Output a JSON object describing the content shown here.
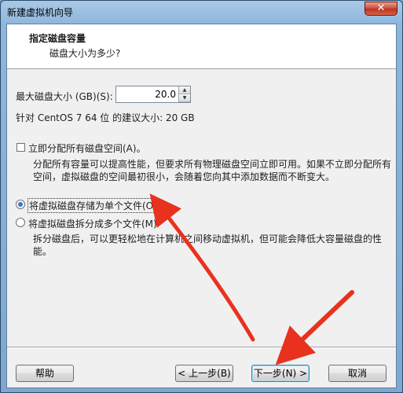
{
  "window": {
    "title": "新建虚拟机向导",
    "close_label": "✕"
  },
  "header": {
    "title": "指定磁盘容量",
    "subtitle": "磁盘大小为多少?"
  },
  "disk": {
    "size_label": "最大磁盘大小 (GB)(S):",
    "size_value": "20.0",
    "recommend_text": "针对 CentOS 7 64 位 的建议大小: 20 GB"
  },
  "options": {
    "allocate_label": "立即分配所有磁盘空间(A)。",
    "allocate_desc_line1": "分配所有容量可以提高性能，但要求所有物理磁盘空间立即可用。如果不立即分配所有",
    "allocate_desc_line2": "空间，虚拟磁盘的空间最初很小，会随着您向其中添加数据而不断变大。",
    "single_file_label": "将虚拟磁盘存储为单个文件(O)",
    "multi_file_label": "将虚拟磁盘拆分成多个文件(M)",
    "multi_file_desc_line1": "拆分磁盘后，可以更轻松地在计算机之间移动虚拟机，但可能会降低大容量磁盘的性",
    "multi_file_desc_line2": "能。"
  },
  "buttons": {
    "help": "帮助",
    "back": "< 上一步(B)",
    "next": "下一步(N) >",
    "cancel": "取消"
  },
  "colors": {
    "arrow": "#e8321e",
    "accent": "#3c7fb1"
  }
}
